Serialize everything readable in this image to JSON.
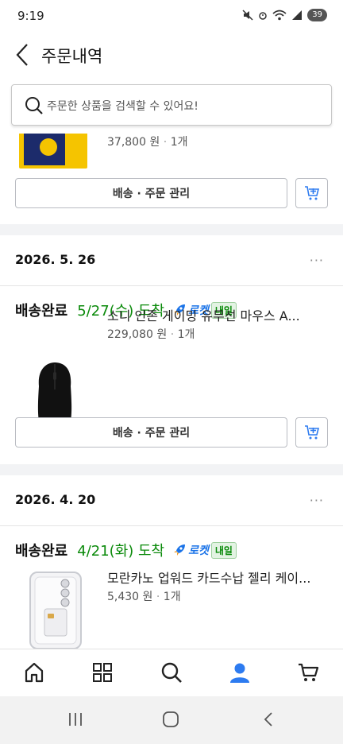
{
  "status_bar": {
    "time": "9:19",
    "battery": "39"
  },
  "header": {
    "title": "주문내역"
  },
  "search": {
    "placeholder": "주문한 상품을 검색할 수 있어요!"
  },
  "orders": [
    {
      "price": "37,800 원",
      "qty": "1개",
      "manage_label": "배송 · 주문 관리"
    },
    {
      "date": "2026. 5. 26",
      "more": "···",
      "status": "배송완료",
      "arrival": "5/27(수) 도착",
      "rocket_label": "로켓",
      "tomorrow_label": "내일",
      "product_name": "소니 인존 게이밍 유무선 마우스 A...",
      "price": "229,080 원",
      "qty": "1개",
      "manage_label": "배송 · 주문 관리"
    },
    {
      "date": "2026. 4. 20",
      "more": "···",
      "status": "배송완료",
      "arrival": "4/21(화) 도착",
      "rocket_label": "로켓",
      "tomorrow_label": "내일",
      "product_name": "모란카노 업워드 카드수납 젤리 케이...",
      "price": "5,430 원",
      "qty": "1개"
    }
  ],
  "price_separator": "·",
  "colors": {
    "arrival_green": "#0a8a0a",
    "rocket_blue": "#1a73e8",
    "active_nav": "#2d7bf0"
  },
  "bottom_nav": [
    "home-icon",
    "category-grid-icon",
    "search-icon",
    "profile-icon",
    "cart-icon"
  ],
  "system_nav": [
    "recent-apps-icon",
    "home-button-icon",
    "back-icon"
  ]
}
